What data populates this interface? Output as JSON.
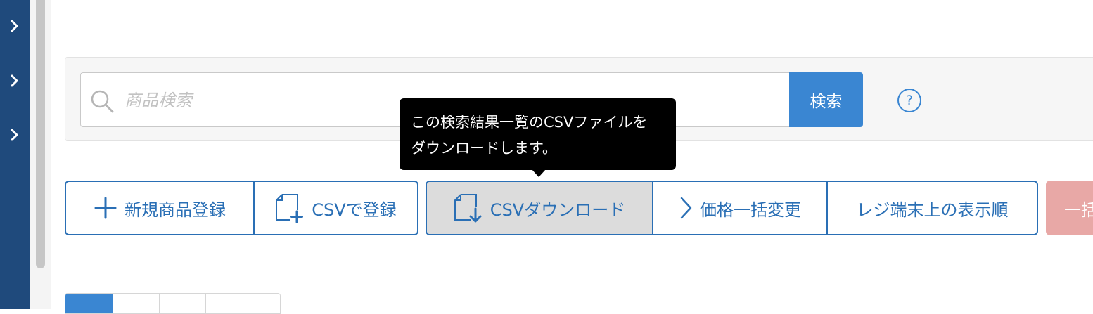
{
  "sidebar": {
    "toggles": [
      {
        "icon": "chevron-right-icon"
      },
      {
        "icon": "chevron-right-icon"
      },
      {
        "icon": "chevron-right-icon"
      }
    ]
  },
  "search": {
    "placeholder": "商品検索",
    "value": "",
    "button_label": "検索",
    "help_label": "?"
  },
  "toolbar": {
    "add_product_label": "新規商品登録",
    "csv_register_label": "CSVで登録",
    "csv_download_label": "CSVダウンロード",
    "bulk_price_label": "価格一括変更",
    "register_order_label": "レジ端末上の表示順",
    "bulk_action_label": "一括"
  },
  "tooltip": {
    "line1": "この検索結果一覧のCSVファイルを",
    "line2": "ダウンロードします。"
  },
  "colors": {
    "sidebar": "#1f4a7c",
    "accent": "#3a86d2",
    "button_border": "#2a6fb5",
    "danger_disabled": "#e8a8a6"
  }
}
